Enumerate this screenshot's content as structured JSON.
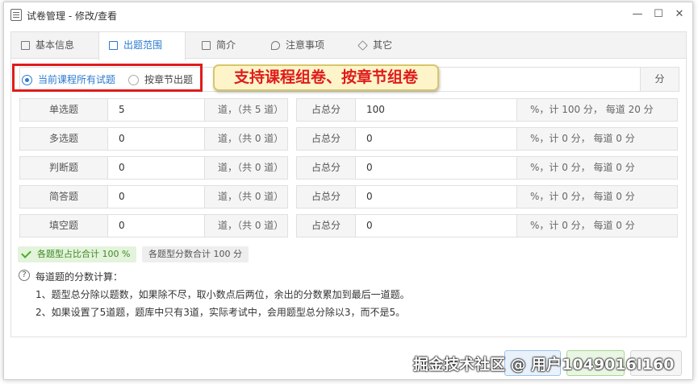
{
  "window": {
    "title": "试卷管理 - 修改/查看"
  },
  "tabs": [
    {
      "label": "基本信息"
    },
    {
      "label": "出题范围"
    },
    {
      "label": "简介"
    },
    {
      "label": "注意事项"
    },
    {
      "label": "其它"
    }
  ],
  "mode": {
    "option_all": "当前课程所有试题",
    "option_chapter": "按章节出题",
    "unit": "分"
  },
  "callout": "支持课程组卷、按章节组卷",
  "rows": [
    {
      "type": "单选题",
      "count": "5",
      "count_note": "道，（共 5 道）",
      "pct_label": "占总分",
      "pct": "100",
      "pct_note": "%，计 100 分， 每道 20 分"
    },
    {
      "type": "多选题",
      "count": "0",
      "count_note": "道，（共 0 道）",
      "pct_label": "占总分",
      "pct": "0",
      "pct_note": "%，计 0 分， 每道 0 分"
    },
    {
      "type": "判断题",
      "count": "0",
      "count_note": "道，（共 0 道）",
      "pct_label": "占总分",
      "pct": "0",
      "pct_note": "%，计 0 分， 每道 0 分"
    },
    {
      "type": "简答题",
      "count": "0",
      "count_note": "道，（共 0 道）",
      "pct_label": "占总分",
      "pct": "0",
      "pct_note": "%，计 0 分， 每道 0 分"
    },
    {
      "type": "填空题",
      "count": "0",
      "count_note": "道，（共 0 道）",
      "pct_label": "占总分",
      "pct": "0",
      "pct_note": "%，计 0 分， 每道 0 分"
    }
  ],
  "summary": {
    "pct_total": "各题型占比合计 100 %",
    "score_total": "各题型分数合计 100 分"
  },
  "help": {
    "title": "每道题的分数计算：",
    "lines": [
      "1、题型总分除以题数，如果除不尽，取小数点后两位，余出的分数累加到最后一道题。",
      "2、如果设置了5道题，题库中只有3道，实际考试中，会用题型总分除以3，而不是5。"
    ]
  },
  "watermark": "掘金技术社区 @ 用户1049016I160",
  "colors": {
    "accent": "#2a7ad0",
    "highlight_red": "#e01b1b",
    "success": "#4caf2a"
  }
}
